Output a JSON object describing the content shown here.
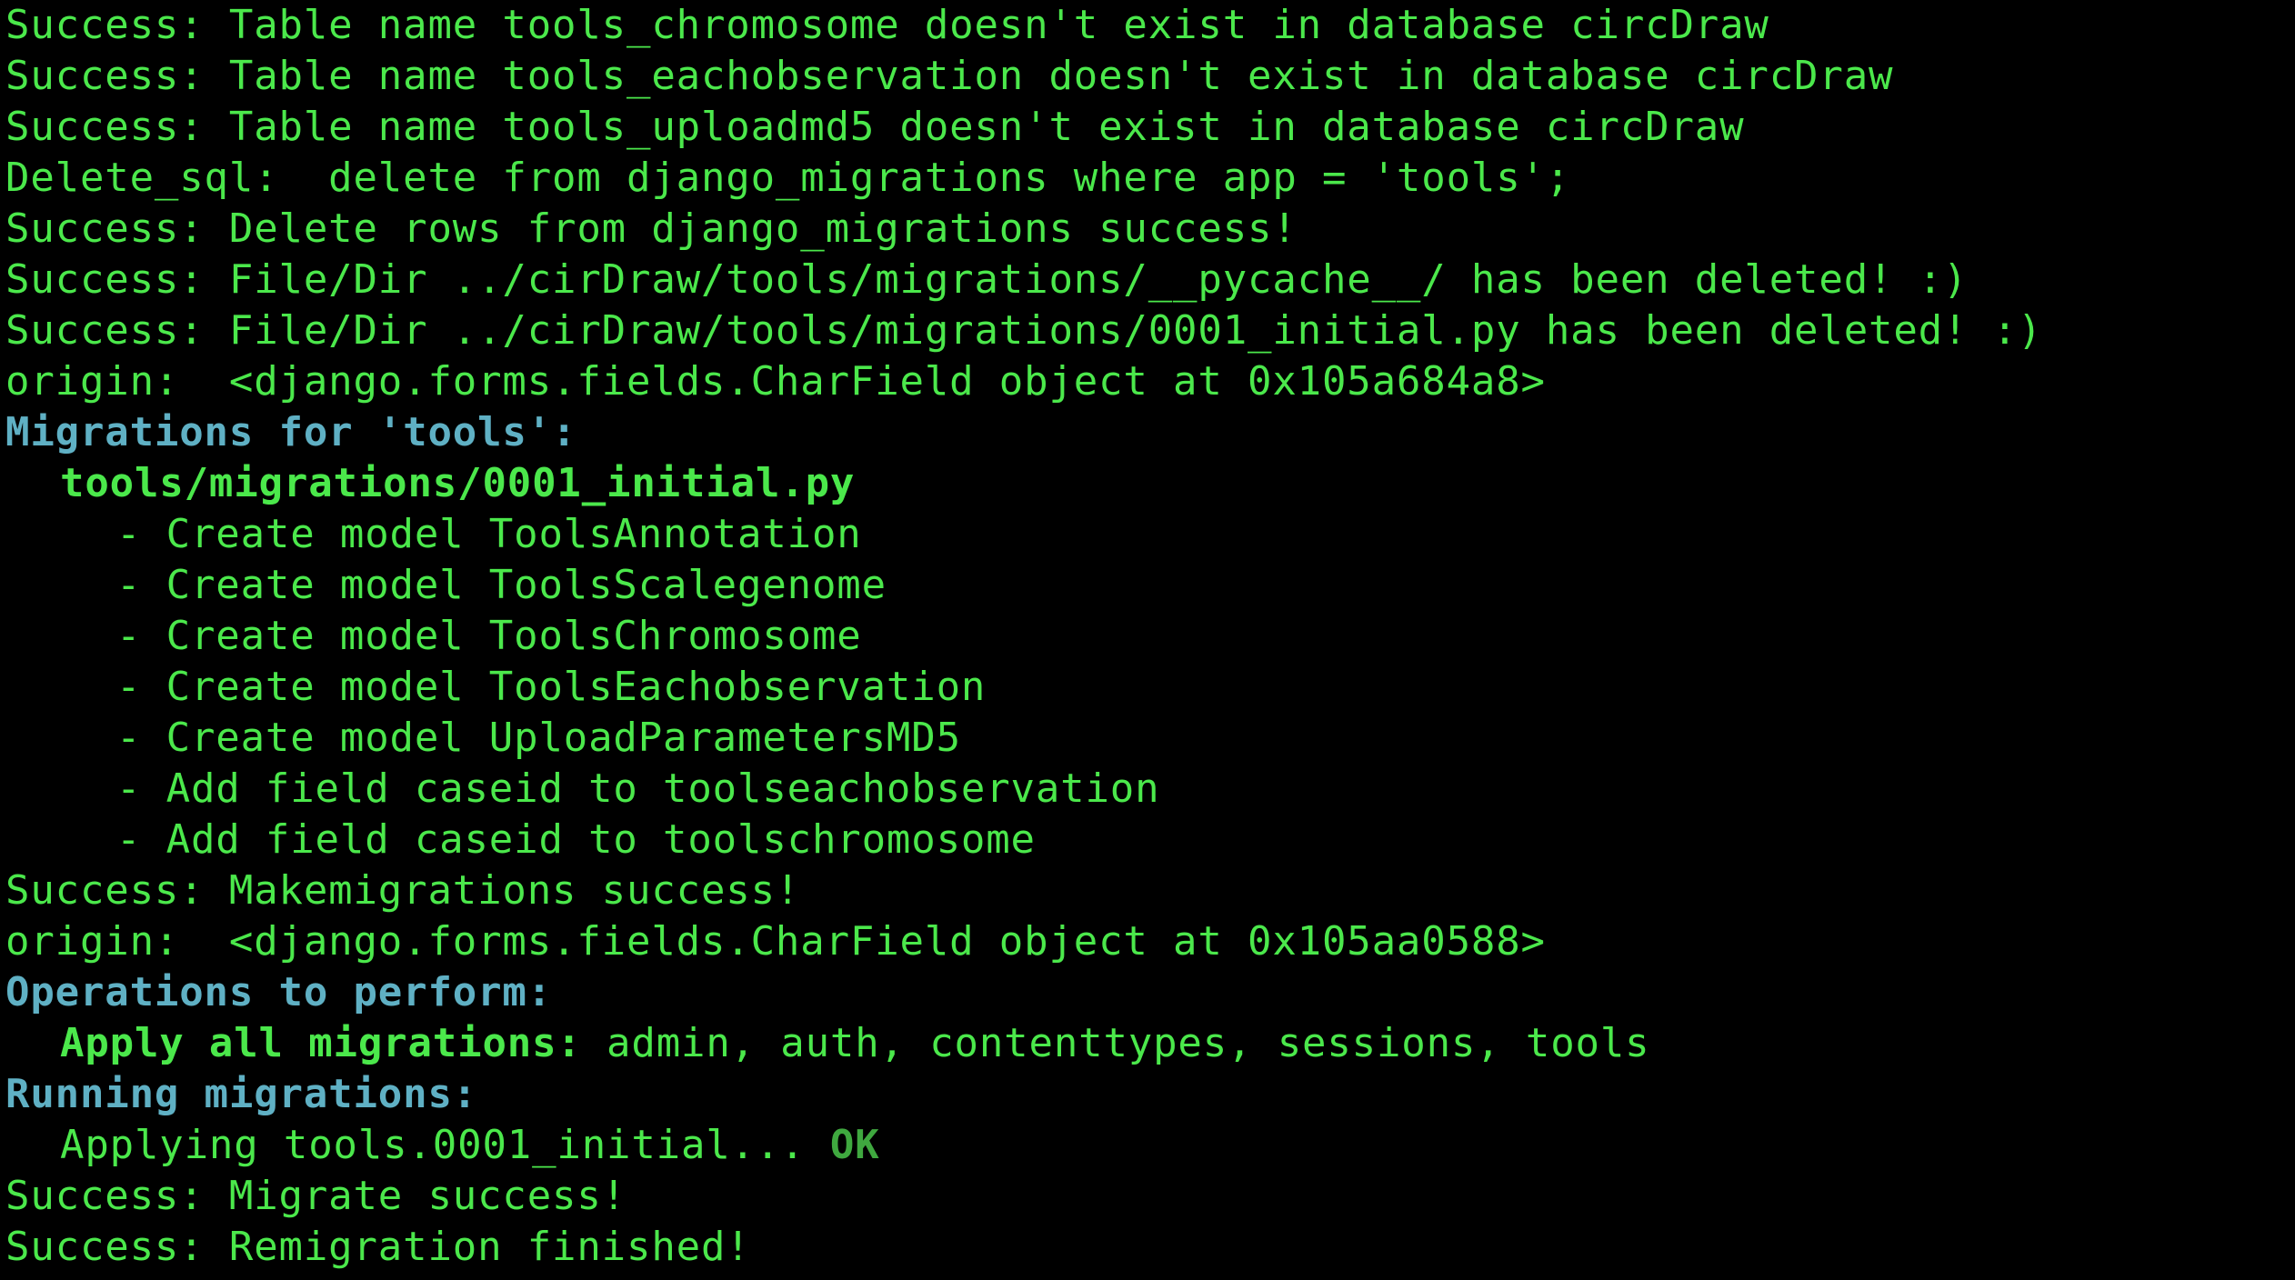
{
  "terminal": {
    "lines": [
      "Success: Table name tools_chromosome doesn't exist in database circDraw",
      "Success: Table name tools_eachobservation doesn't exist in database circDraw",
      "Success: Table name tools_uploadmd5 doesn't exist in database circDraw",
      "Delete_sql:  delete from django_migrations where app = 'tools';",
      "Success: Delete rows from django_migrations success!",
      "Success: File/Dir ../cirDraw/tools/migrations/__pycache__/ has been deleted! :)",
      "Success: File/Dir ../cirDraw/tools/migrations/0001_initial.py has been deleted! :)",
      "origin:  <django.forms.fields.CharField object at 0x105a684a8>",
      "Migrations for 'tools':",
      "tools/migrations/0001_initial.py",
      "- Create model ToolsAnnotation",
      "- Create model ToolsScalegenome",
      "- Create model ToolsChromosome",
      "- Create model ToolsEachobservation",
      "- Create model UploadParametersMD5",
      "- Add field caseid to toolseachobservation",
      "- Add field caseid to toolschromosome",
      "Success: Makemigrations success!",
      "origin:  <django.forms.fields.CharField object at 0x105aa0588>",
      "Operations to perform:",
      "Apply all migrations:",
      " admin, auth, contenttypes, sessions, tools",
      "Running migrations:",
      "Applying tools.0001_initial...",
      " OK",
      "Success: Migrate success!",
      "Success: Remigration finished!"
    ]
  },
  "colors": {
    "background": "#000000",
    "output_green": "#4be84b",
    "heading_cyan": "#5fb0c4",
    "ok_green": "#3fa83f"
  }
}
